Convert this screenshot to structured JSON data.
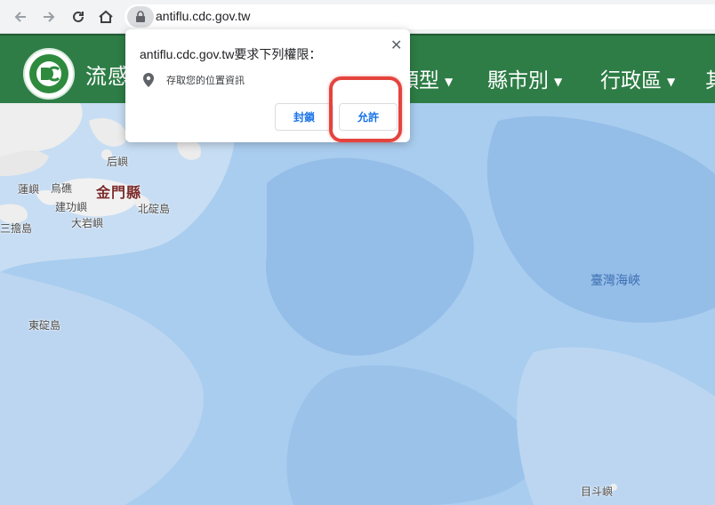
{
  "browser": {
    "url": "antiflu.cdc.gov.tw",
    "icons": [
      "back-icon",
      "forward-icon",
      "reload-icon",
      "home-icon",
      "lock-icon"
    ]
  },
  "site": {
    "title": "流感",
    "nav": [
      {
        "label": "類型"
      },
      {
        "label": "縣市別"
      },
      {
        "label": "行政區"
      },
      {
        "label": "其"
      }
    ],
    "header_color": "#2e7d46"
  },
  "map": {
    "labels": {
      "houyu": "后嶼",
      "liyu": "蓮嶼",
      "wucuo": "烏礁",
      "kinmen": "金門縣",
      "jiangong": "建功嶼",
      "beiding": "北碇島",
      "sandan": "三擔島",
      "dadan": "大岩嶼",
      "dongding": "東碇島",
      "strait": "臺灣海峽",
      "mudou": "目斗嶼"
    }
  },
  "prompt": {
    "title": "antiflu.cdc.gov.tw要求下列權限：",
    "permission": "存取您的位置資訊",
    "block_label": "封鎖",
    "allow_label": "允許",
    "highlight_color": "#e4443e"
  }
}
